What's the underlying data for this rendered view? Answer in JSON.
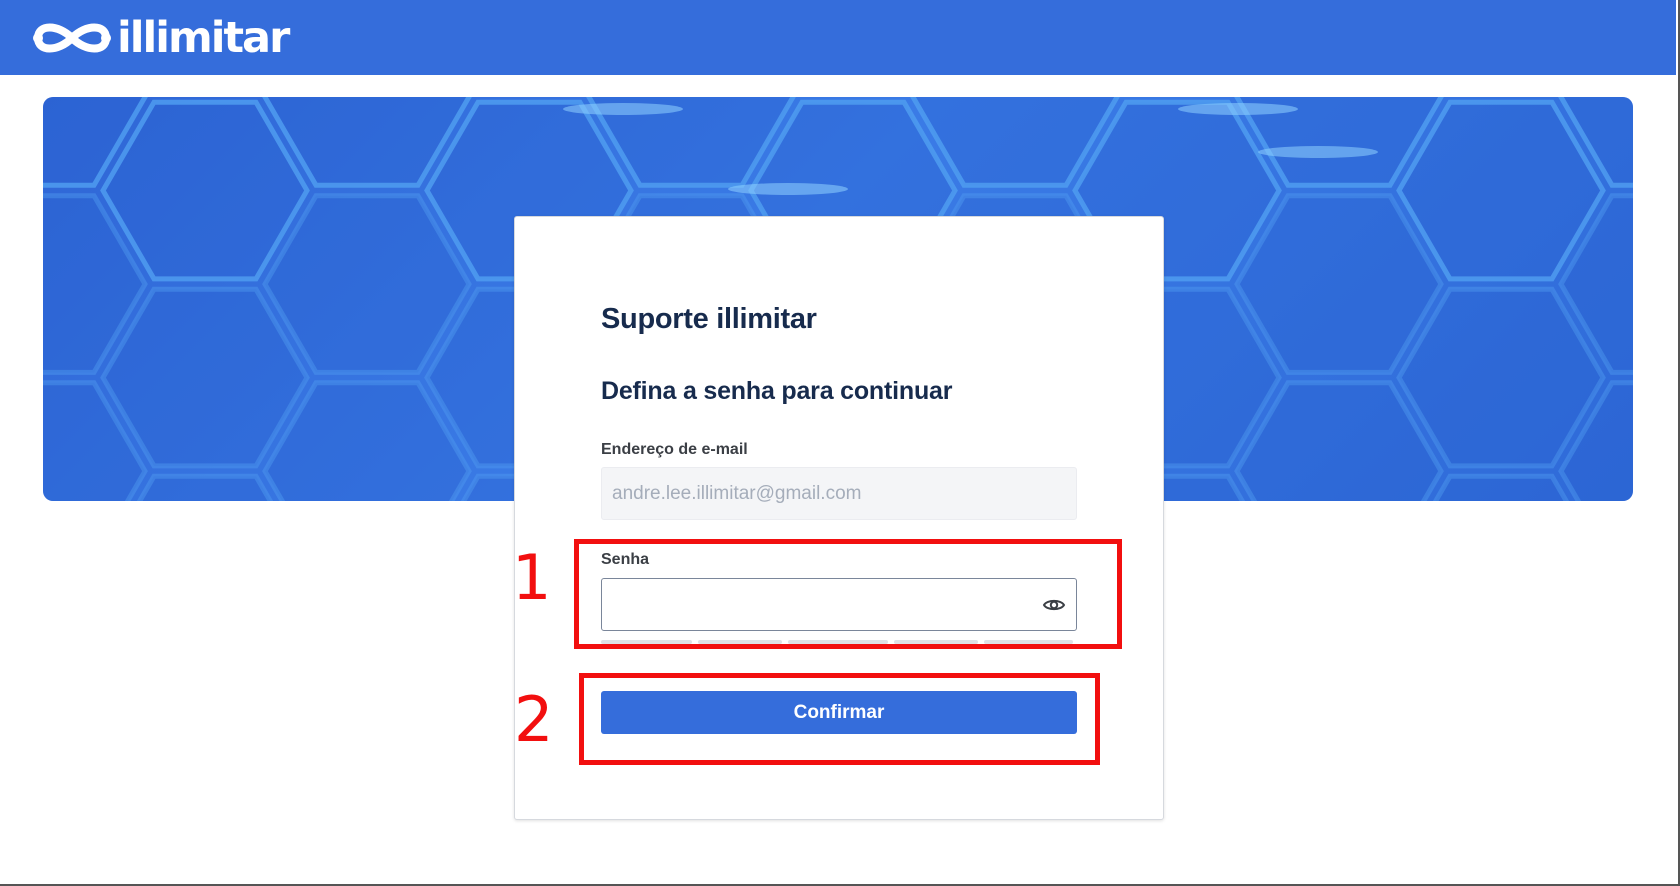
{
  "header": {
    "logo_text": "illimitar",
    "logo_icon": "infinity-icon",
    "background_color": "#356ddb"
  },
  "banner": {
    "pattern": "hexagon-pattern",
    "colors": {
      "base": "#2f66d6",
      "hex_line": "#4f9cf0",
      "hex_glow": "#8fd2ff"
    }
  },
  "card": {
    "title": "Suporte illimitar",
    "subtitle": "Defina a senha para continuar",
    "email": {
      "label": "Endereço de e-mail",
      "value": "andre.lee.illimitar@gmail.com"
    },
    "password": {
      "label": "Senha",
      "value": "",
      "toggle_icon": "eye-icon"
    },
    "confirm_label": "Confirmar",
    "colors": {
      "title": "#172b4d",
      "button": "#356ddb"
    }
  },
  "annotations": [
    {
      "label": "1",
      "color": "#f20f0f"
    },
    {
      "label": "2",
      "color": "#f20f0f"
    }
  ]
}
